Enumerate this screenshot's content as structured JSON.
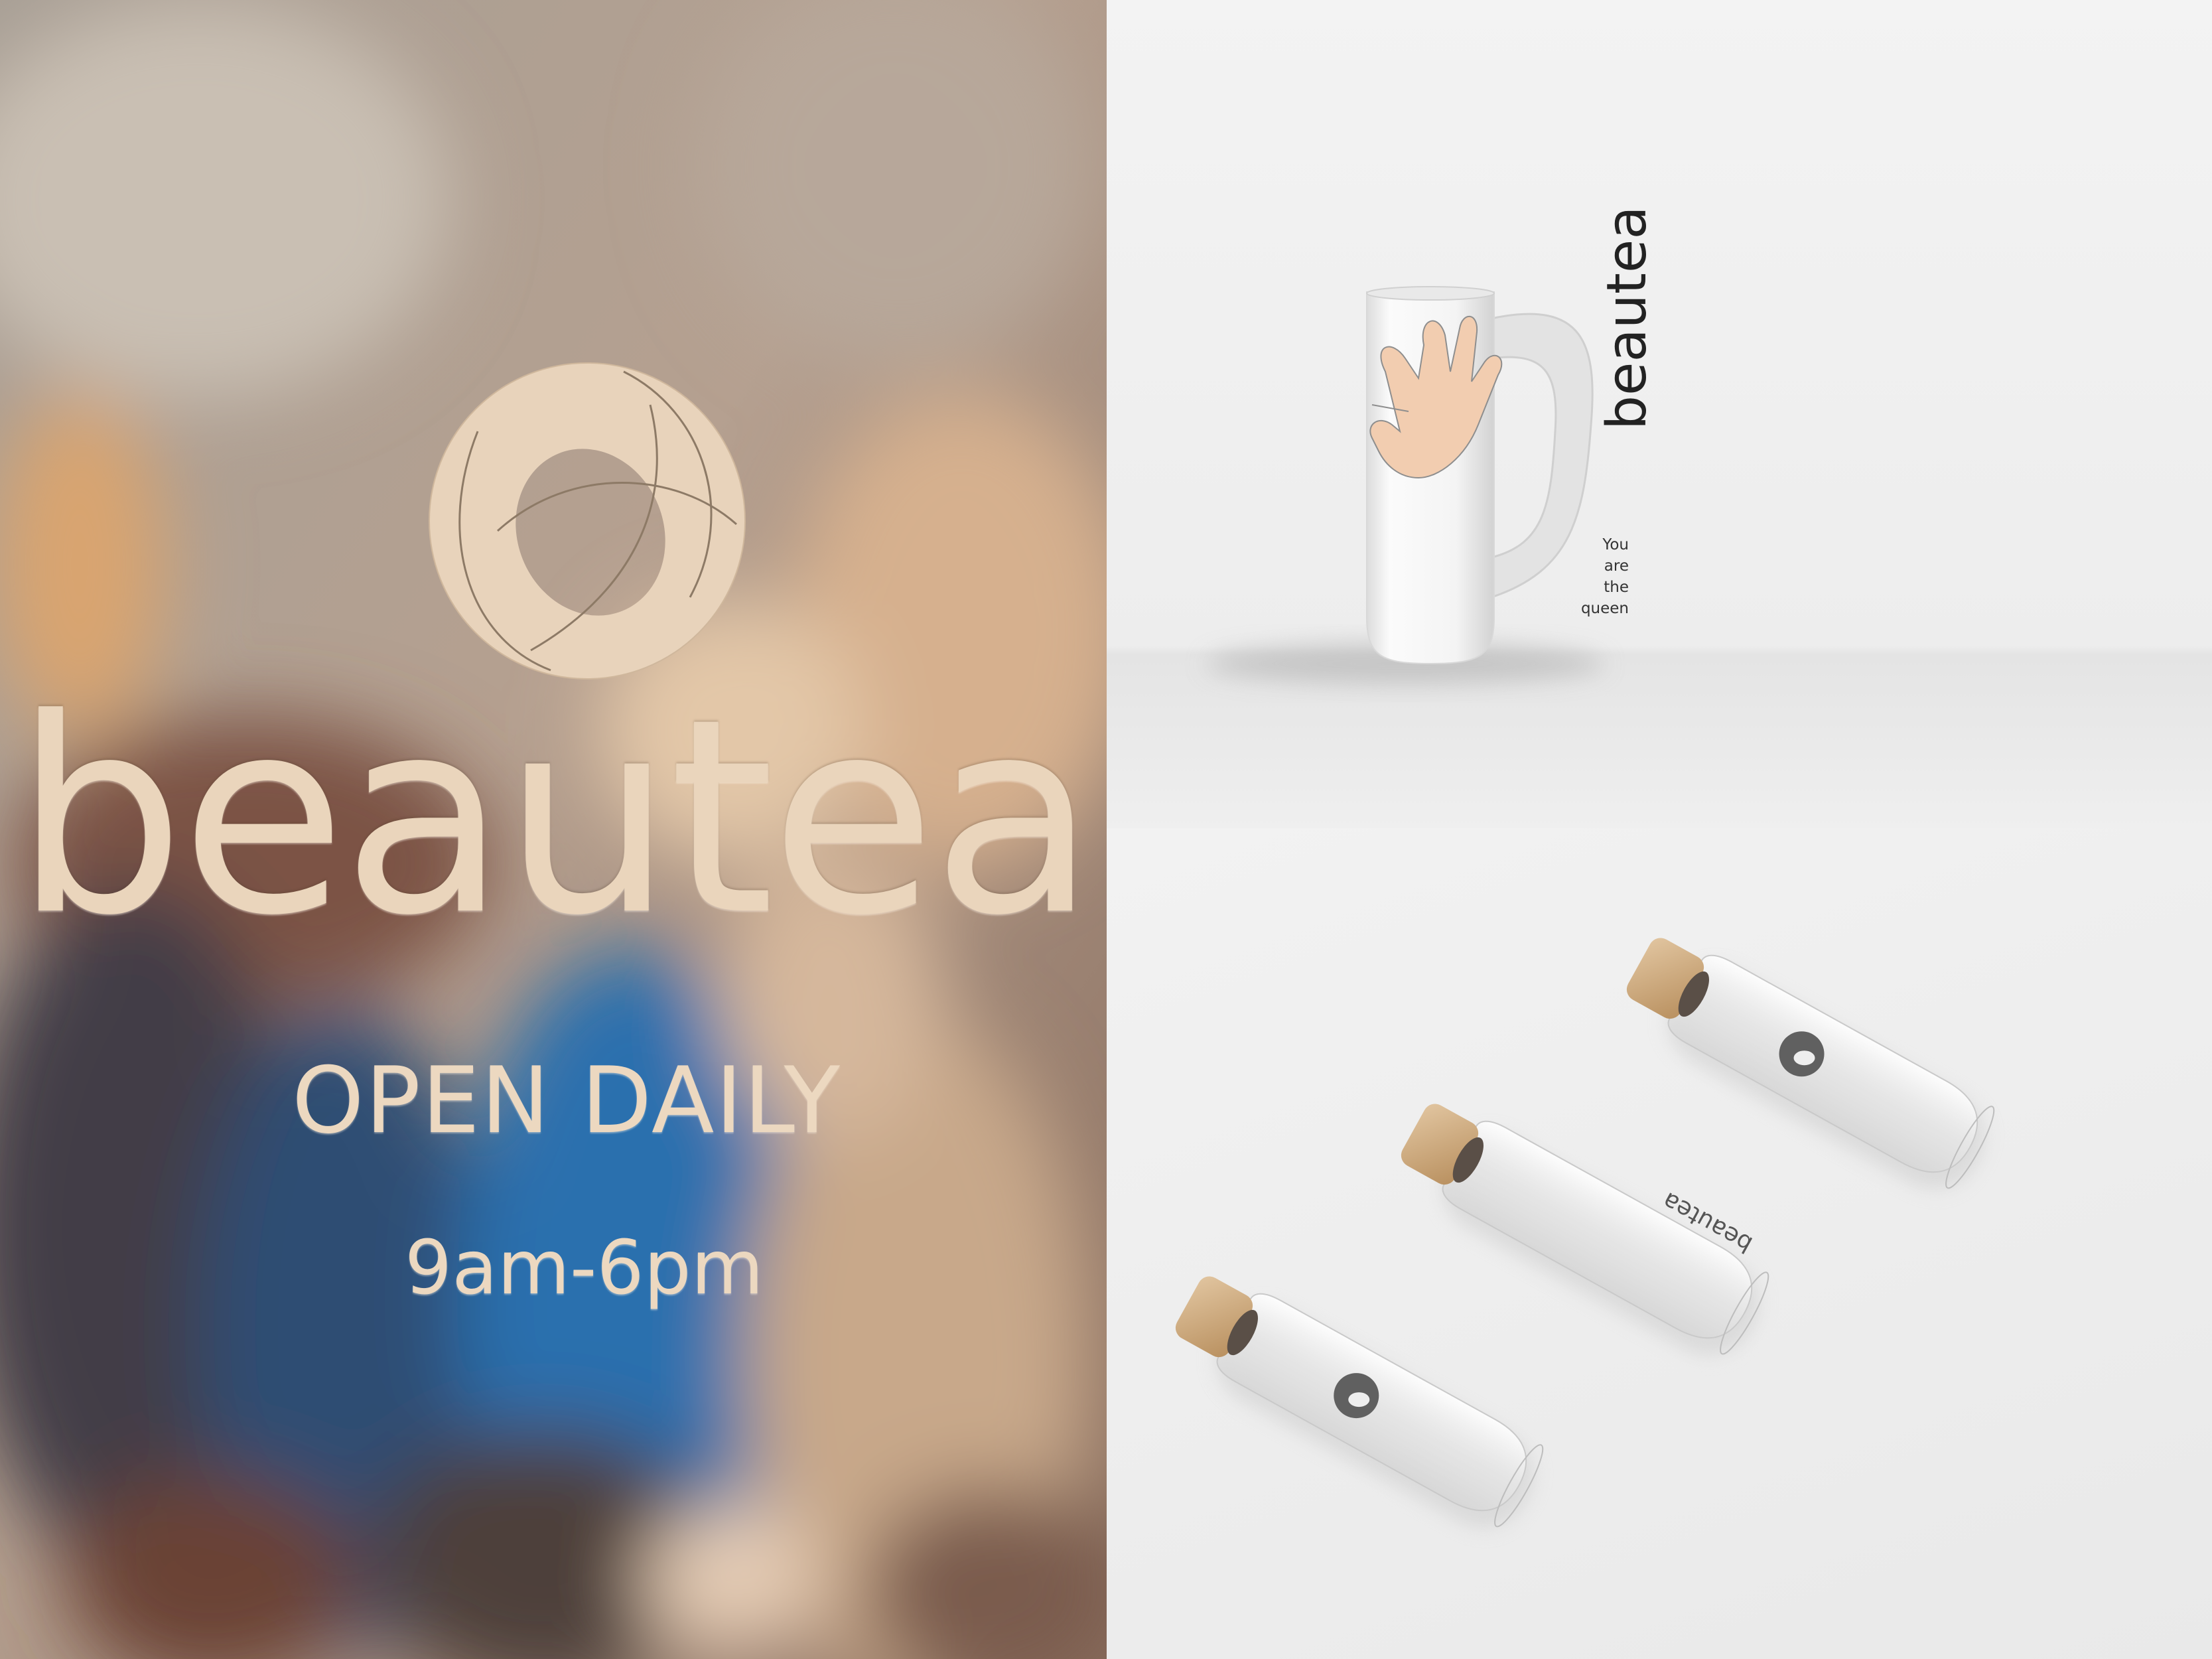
{
  "door": {
    "brand": "beautea",
    "open_label": "OPEN DAILY",
    "hours": "9am-6pm"
  },
  "mug": {
    "brand": "beautea",
    "tag_lines": [
      "You",
      "are",
      "the",
      "queen"
    ]
  },
  "bottles": {
    "brand": "beautea"
  },
  "colors": {
    "gold_lettering": "#ead5bc",
    "mug_accent": "#e8a424",
    "cork": "#c9a373"
  },
  "icons": [
    "beautea-circle-logo-icon",
    "hand-print-icon"
  ]
}
